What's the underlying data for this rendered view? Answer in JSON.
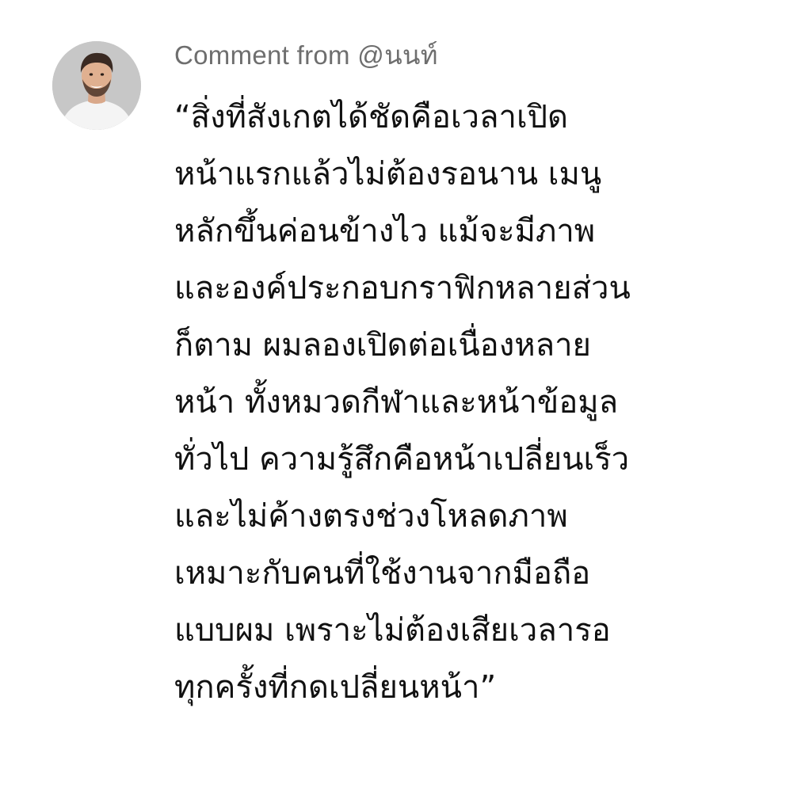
{
  "comment": {
    "author_line": "Comment from @นนท์",
    "avatar_icon": "person-avatar-icon",
    "lines": [
      "“สิ่งที่สังเกตได้ชัดคือเวลาเปิด",
      "หน้าแรกแล้วไม่ต้องรอนาน เมนู",
      "หลักขึ้นค่อนข้างไว แม้จะมีภาพ",
      "และองค์ประกอบกราฟิกหลายส่วน",
      "ก็ตาม ผมลองเปิดต่อเนื่องหลาย",
      "หน้า ทั้งหมวดกีฬาและหน้าข้อมูล",
      "ทั่วไป ความรู้สึกคือหน้าเปลี่ยนเร็ว",
      "และไม่ค้างตรงช่วงโหลดภาพ",
      "เหมาะกับคนที่ใช้งานจากมือถือ",
      "แบบผม เพราะไม่ต้องเสียเวลารอ",
      "ทุกครั้งที่กดเปลี่ยนหน้า”"
    ]
  },
  "colors": {
    "background": "#ffffff",
    "author_text": "#6e6e6e",
    "body_text": "#111111"
  }
}
